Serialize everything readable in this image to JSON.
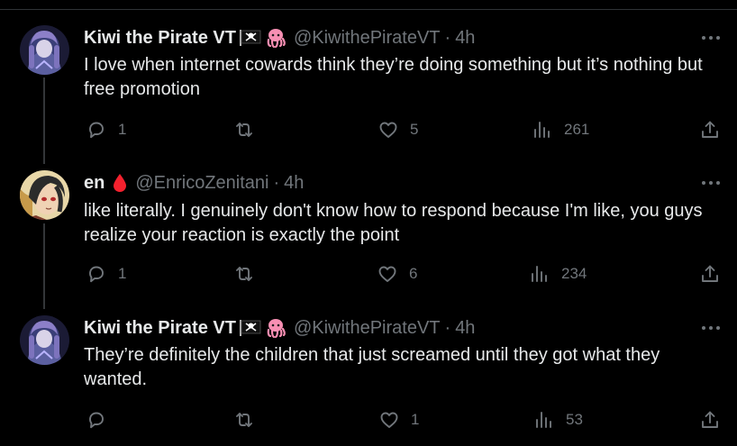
{
  "colors": {
    "background": "#000000",
    "text": "#e7e9ea",
    "secondary": "#71767b",
    "thread_line": "#333639",
    "blood_drop": "#f4212e"
  },
  "tweets": [
    {
      "name": "Kiwi the Pirate VT",
      "emojis": [
        "pirate-flag",
        "octopus"
      ],
      "handle": "@KiwithePirateVT",
      "separator": "·",
      "time": "4h",
      "text": "I love when internet cowards think they’re doing something but it’s nothing but free promotion",
      "replies": "1",
      "retweets": "",
      "likes": "5",
      "views": "261"
    },
    {
      "name": "en",
      "emojis": [
        "drop-of-blood"
      ],
      "handle": "@EnricoZenitani",
      "separator": "·",
      "time": "4h",
      "text": "like literally. I genuinely don't know how to respond because I'm like, you guys realize your reaction is exactly the point",
      "replies": "1",
      "retweets": "",
      "likes": "6",
      "views": "234"
    },
    {
      "name": "Kiwi the Pirate VT",
      "emojis": [
        "pirate-flag",
        "octopus"
      ],
      "handle": "@KiwithePirateVT",
      "separator": "·",
      "time": "4h",
      "text": "They’re definitely the children that just screamed until they got what they wanted.",
      "replies": "",
      "retweets": "",
      "likes": "1",
      "views": "53"
    }
  ]
}
